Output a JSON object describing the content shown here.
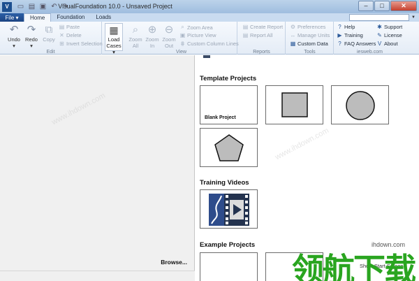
{
  "window": {
    "title": "VisualFoundation 10.0 - Unsaved Project"
  },
  "tabs": {
    "file": "File ▾",
    "items": [
      "Home",
      "Foundation",
      "Loads"
    ]
  },
  "ribbon": {
    "edit": {
      "label": "Edit",
      "undo": "Undo",
      "redo": "Redo",
      "copy": "Copy",
      "paste": "Paste",
      "delete": "Delete",
      "invert": "Invert Selection"
    },
    "load": {
      "label_line1": "Load",
      "label_line2": "Cases ▾"
    },
    "view": {
      "label": "View",
      "zoom_all_1": "Zoom",
      "zoom_all_2": "All",
      "zoom_in_1": "Zoom",
      "zoom_in_2": "In",
      "zoom_out_1": "Zoom",
      "zoom_out_2": "Out",
      "zoom_area": "Zoom Area",
      "picture_view": "Picture View",
      "custom_lines": "Custom Column Lines"
    },
    "reports": {
      "label": "Reports",
      "create": "Create Report",
      "all": "Report All"
    },
    "tools": {
      "label": "Tools",
      "preferences": "Preferences",
      "manage_units": "Manage Units",
      "custom_data": "Custom Data"
    },
    "help": {
      "help": "Help",
      "training": "Training",
      "faq": "FAQ Answers",
      "support": "Support",
      "license": "License",
      "about": "About",
      "site": "iesweb.com"
    }
  },
  "left": {
    "browse": "Browse..."
  },
  "right": {
    "template_title": "Template Projects",
    "blank_caption": "Blank Project",
    "training_title": "Training Videos",
    "example_title": "Example Projects",
    "status": "Show Start Screen"
  },
  "watermark": {
    "brand": "领航下载",
    "site": "ihdown.com",
    "diag": "www.ihdown.com"
  }
}
